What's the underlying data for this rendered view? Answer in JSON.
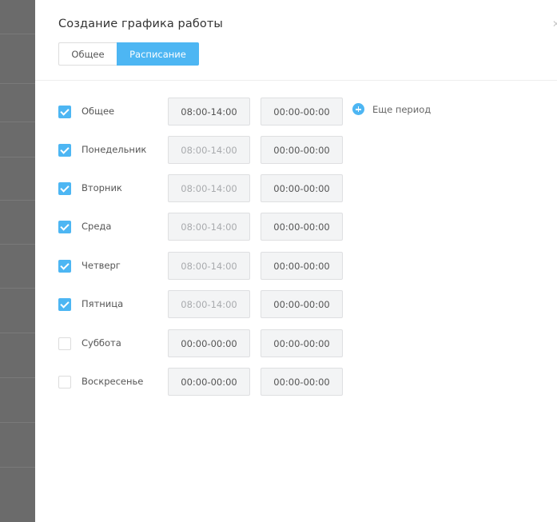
{
  "window": {
    "title": "Создание графика работы",
    "close_icon": "close-icon"
  },
  "tabs": [
    {
      "label": "Общее",
      "active": false
    },
    {
      "label": "Расписание",
      "active": true
    }
  ],
  "add_period": {
    "label": "Еще период",
    "icon": "plus-circle-icon"
  },
  "colors": {
    "accent": "#4db6f3",
    "field_bg": "#f3f4f5",
    "backdrop": "#6b6b6b"
  },
  "rows": [
    {
      "label": "Общее",
      "checked": true,
      "period1": "08:00-14:00",
      "period1_muted": false,
      "period2": "00:00-00:00"
    },
    {
      "label": "Понедельник",
      "checked": true,
      "period1": "08:00-14:00",
      "period1_muted": true,
      "period2": "00:00-00:00"
    },
    {
      "label": "Вторник",
      "checked": true,
      "period1": "08:00-14:00",
      "period1_muted": true,
      "period2": "00:00-00:00"
    },
    {
      "label": "Среда",
      "checked": true,
      "period1": "08:00-14:00",
      "period1_muted": true,
      "period2": "00:00-00:00"
    },
    {
      "label": "Четверг",
      "checked": true,
      "period1": "08:00-14:00",
      "period1_muted": true,
      "period2": "00:00-00:00"
    },
    {
      "label": "Пятница",
      "checked": true,
      "period1": "08:00-14:00",
      "period1_muted": true,
      "period2": "00:00-00:00"
    },
    {
      "label": "Суббота",
      "checked": false,
      "period1": "00:00-00:00",
      "period1_muted": false,
      "period2": "00:00-00:00"
    },
    {
      "label": "Воскресенье",
      "checked": false,
      "period1": "00:00-00:00",
      "period1_muted": false,
      "period2": "00:00-00:00"
    }
  ]
}
